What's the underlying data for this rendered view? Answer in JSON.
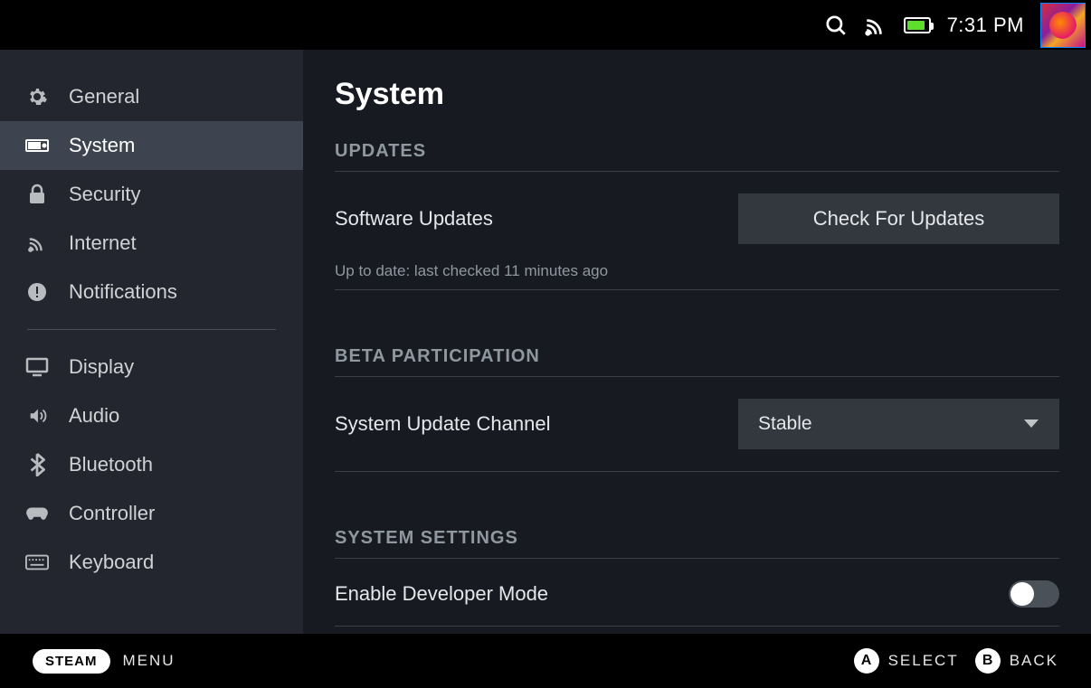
{
  "topbar": {
    "clock": "7:31 PM"
  },
  "sidebar": {
    "items": [
      {
        "label": "General",
        "icon": "gear"
      },
      {
        "label": "System",
        "icon": "console",
        "active": true
      },
      {
        "label": "Security",
        "icon": "lock"
      },
      {
        "label": "Internet",
        "icon": "wifi"
      },
      {
        "label": "Notifications",
        "icon": "alert"
      }
    ],
    "items2": [
      {
        "label": "Display",
        "icon": "monitor"
      },
      {
        "label": "Audio",
        "icon": "speaker"
      },
      {
        "label": "Bluetooth",
        "icon": "bluetooth"
      },
      {
        "label": "Controller",
        "icon": "controller"
      },
      {
        "label": "Keyboard",
        "icon": "keyboard"
      }
    ]
  },
  "main": {
    "title": "System",
    "updates": {
      "header": "UPDATES",
      "row_label": "Software Updates",
      "button": "Check For Updates",
      "status": "Up to date: last checked 11 minutes ago"
    },
    "beta": {
      "header": "BETA PARTICIPATION",
      "row_label": "System Update Channel",
      "value": "Stable"
    },
    "system_settings": {
      "header": "SYSTEM SETTINGS",
      "dev_mode_label": "Enable Developer Mode",
      "dev_mode_on": false
    }
  },
  "footer": {
    "steam": "STEAM",
    "menu": "MENU",
    "select": "SELECT",
    "back": "BACK",
    "a": "A",
    "b": "B"
  }
}
